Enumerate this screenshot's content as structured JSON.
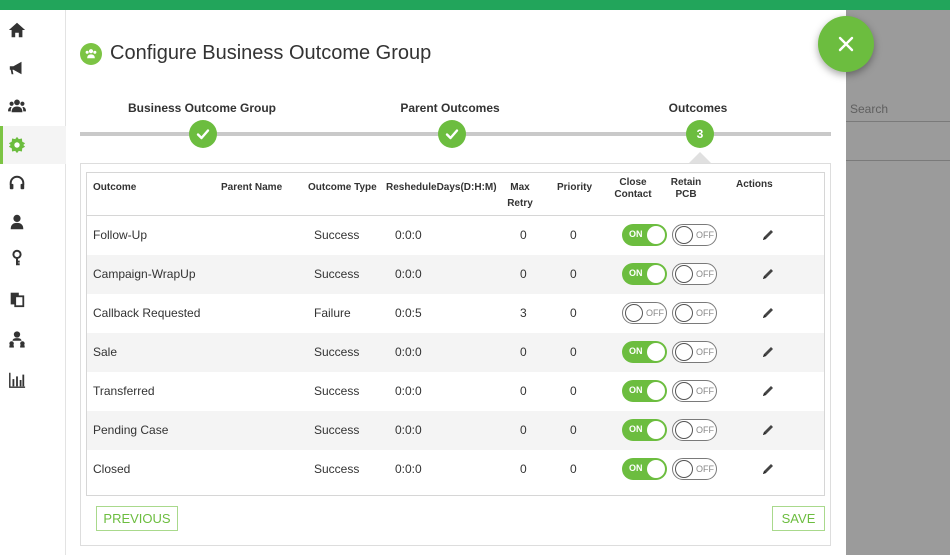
{
  "sidebar": {
    "items": [
      {
        "icon": "home-icon"
      },
      {
        "icon": "megaphone-icon"
      },
      {
        "icon": "users-icon"
      },
      {
        "icon": "gear-icon",
        "active": true
      },
      {
        "icon": "headset-icon"
      },
      {
        "icon": "user-icon"
      },
      {
        "icon": "key-icon"
      },
      {
        "icon": "documents-icon"
      },
      {
        "icon": "org-chart-icon"
      },
      {
        "icon": "bar-chart-icon"
      }
    ]
  },
  "background": {
    "search_placeholder": "Search"
  },
  "modal": {
    "title": "Configure Business Outcome Group",
    "steps": [
      {
        "label": "Business Outcome Group",
        "state": "done"
      },
      {
        "label": "Parent Outcomes",
        "state": "done"
      },
      {
        "label": "Outcomes",
        "state": "current",
        "number": "3"
      }
    ],
    "table": {
      "headers": {
        "outcome": "Outcome",
        "parent_name": "Parent Name",
        "outcome_type": "Outcome Type",
        "reschedule": "ResheduleDays(D:H:M)",
        "max_retry_1": "Max",
        "max_retry_2": "Retry",
        "priority": "Priority",
        "close_contact_1": "Close",
        "close_contact_2": "Contact",
        "retain_pcb_1": "Retain",
        "retain_pcb_2": "PCB",
        "actions": "Actions"
      },
      "toggle_on": "ON",
      "toggle_off": "OFF",
      "rows": [
        {
          "outcome": "Follow-Up",
          "parent_name": "",
          "type": "Success",
          "reschedule": "0:0:0",
          "max_retry": "0",
          "priority": "0",
          "close_contact": true,
          "retain_pcb": false
        },
        {
          "outcome": "Campaign-WrapUp",
          "parent_name": "",
          "type": "Success",
          "reschedule": "0:0:0",
          "max_retry": "0",
          "priority": "0",
          "close_contact": true,
          "retain_pcb": false
        },
        {
          "outcome": "Callback Requested",
          "parent_name": "",
          "type": "Failure",
          "reschedule": "0:0:5",
          "max_retry": "3",
          "priority": "0",
          "close_contact": false,
          "retain_pcb": false
        },
        {
          "outcome": "Sale",
          "parent_name": "",
          "type": "Success",
          "reschedule": "0:0:0",
          "max_retry": "0",
          "priority": "0",
          "close_contact": true,
          "retain_pcb": false
        },
        {
          "outcome": "Transferred",
          "parent_name": "",
          "type": "Success",
          "reschedule": "0:0:0",
          "max_retry": "0",
          "priority": "0",
          "close_contact": true,
          "retain_pcb": false
        },
        {
          "outcome": "Pending Case",
          "parent_name": "",
          "type": "Success",
          "reschedule": "0:0:0",
          "max_retry": "0",
          "priority": "0",
          "close_contact": true,
          "retain_pcb": false
        },
        {
          "outcome": "Closed",
          "parent_name": "",
          "type": "Success",
          "reschedule": "0:0:0",
          "max_retry": "0",
          "priority": "0",
          "close_contact": true,
          "retain_pcb": false
        }
      ]
    },
    "buttons": {
      "previous": "PREVIOUS",
      "save": "SAVE"
    }
  },
  "colors": {
    "brand_green": "#6cbd3f",
    "top_bar": "#22a55b",
    "backdrop": "#9b9b9b"
  }
}
